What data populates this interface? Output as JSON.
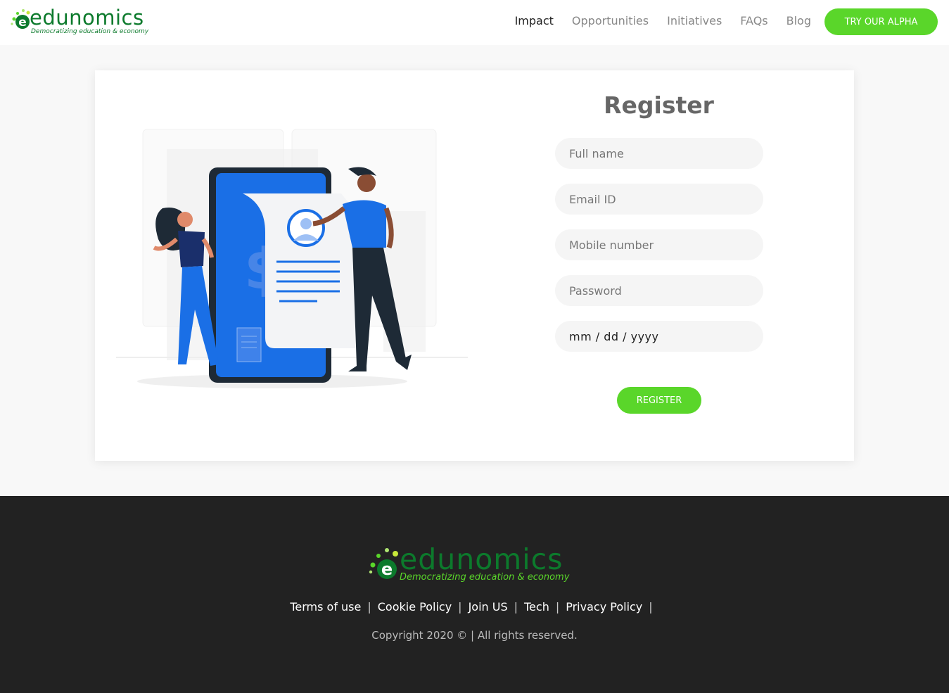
{
  "brand": {
    "name": "edunomics",
    "tagline": "Democratizing education & economy",
    "primary_green": "#5ad62a",
    "dark_green": "#0c7a2c"
  },
  "header": {
    "nav": [
      {
        "label": "Impact",
        "active": true
      },
      {
        "label": "Opportunities",
        "active": false
      },
      {
        "label": "Initiatives",
        "active": false
      },
      {
        "label": "FAQs",
        "active": false
      },
      {
        "label": "Blog",
        "active": false
      }
    ],
    "cta_label": "TRY OUR ALPHA"
  },
  "register": {
    "title": "Register",
    "fields": {
      "full_name": "Full name",
      "email": "Email ID",
      "mobile": "Mobile number",
      "password": "Password",
      "date": "mm / dd / yyyy"
    },
    "button_label": "REGISTER"
  },
  "footer": {
    "links": [
      "Terms of use",
      "Cookie Policy",
      "Join US",
      "Tech",
      "Privacy Policy"
    ],
    "copyright": "Copyright 2020 © | All rights reserved."
  }
}
